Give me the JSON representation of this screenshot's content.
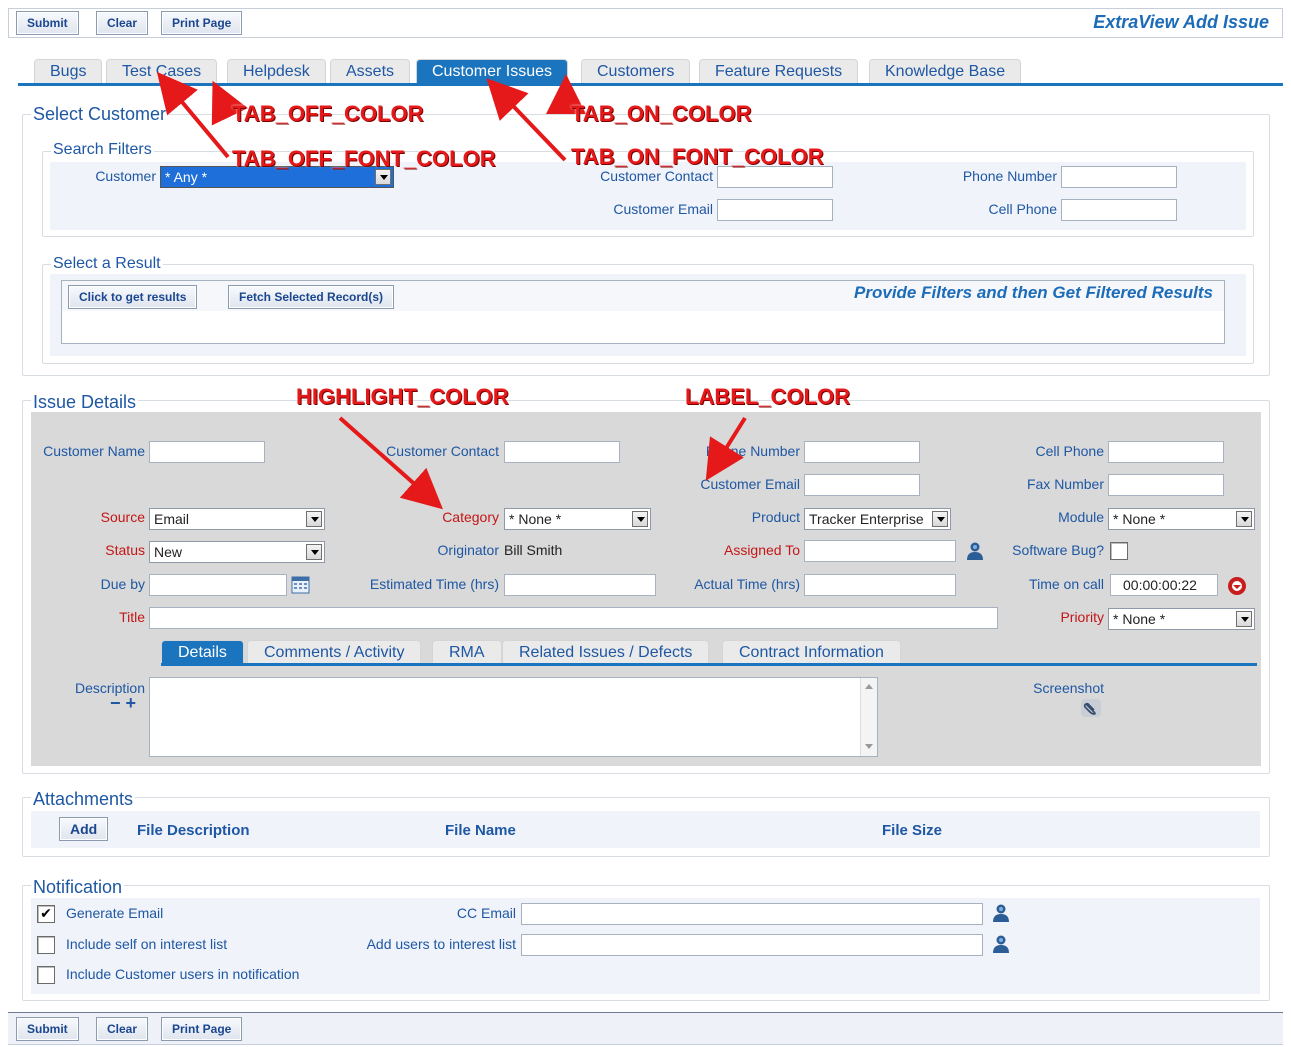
{
  "toolbar": {
    "submit": "Submit",
    "clear": "Clear",
    "print": "Print Page",
    "title": "ExtraView Add Issue"
  },
  "tabs": [
    "Bugs",
    "Test Cases",
    "Helpdesk",
    "Assets",
    "Customer Issues",
    "Customers",
    "Feature Requests",
    "Knowledge Base"
  ],
  "select_customer": {
    "legend": "Select Customer",
    "search_filters": {
      "legend": "Search Filters",
      "customer_label": "Customer",
      "customer_value": "* Any *",
      "customer_contact_label": "Customer Contact",
      "customer_email_label": "Customer Email",
      "phone_number_label": "Phone Number",
      "cell_phone_label": "Cell Phone"
    },
    "select_result": {
      "legend": "Select a Result",
      "get_results": "Click to get results",
      "fetch_selected": "Fetch Selected Record(s)",
      "hint": "Provide Filters and then Get Filtered Results"
    }
  },
  "issue_details": {
    "legend": "Issue Details",
    "customer_name_label": "Customer Name",
    "customer_contact_label": "Customer Contact",
    "phone_number_label": "Phone Number",
    "cell_phone_label": "Cell Phone",
    "customer_email_label": "Customer Email",
    "fax_number_label": "Fax Number",
    "source_label": "Source",
    "source_value": "Email",
    "category_label": "Category",
    "category_value": "* None *",
    "product_label": "Product",
    "product_value": "Tracker Enterprise",
    "module_label": "Module",
    "module_value": "* None *",
    "status_label": "Status",
    "status_value": "New",
    "originator_label": "Originator",
    "originator_value": "Bill Smith",
    "assigned_to_label": "Assigned To",
    "software_bug_label": "Software Bug?",
    "due_by_label": "Due by",
    "estimated_time_label": "Estimated Time (hrs)",
    "actual_time_label": "Actual Time (hrs)",
    "time_on_call_label": "Time on call",
    "time_on_call_value": "00:00:00:22",
    "title_label": "Title",
    "priority_label": "Priority",
    "priority_value": "* None *",
    "sub_tabs": [
      "Details",
      "Comments / Activity",
      "RMA",
      "Related Issues / Defects",
      "Contract Information"
    ],
    "description_label": "Description",
    "desc_minus": "−",
    "desc_plus": "+",
    "screenshot_label": "Screenshot"
  },
  "attachments": {
    "legend": "Attachments",
    "add": "Add",
    "columns": [
      "File Description",
      "File Name",
      "File Size"
    ]
  },
  "notification": {
    "legend": "Notification",
    "generate_email": "Generate Email",
    "include_self": "Include self on interest list",
    "include_customer": "Include Customer users in notification",
    "cc_email_label": "CC Email",
    "add_users_label": "Add users to interest list"
  },
  "annotations": {
    "tab_off_color": "TAB_OFF_COLOR",
    "tab_off_font_color": "TAB_OFF_FONT_COLOR",
    "tab_on_color": "TAB_ON_COLOR",
    "tab_on_font_color": "TAB_ON_FONT_COLOR",
    "highlight_color": "HIGHLIGHT_COLOR",
    "label_color": "LABEL_COLOR"
  },
  "colors": {
    "accent": "#1b74be",
    "label": "#1e57a3",
    "required": "#c41616",
    "annotation": "#e51919",
    "panel": "#f0f3fa",
    "details_bg": "#d9d9d9"
  }
}
